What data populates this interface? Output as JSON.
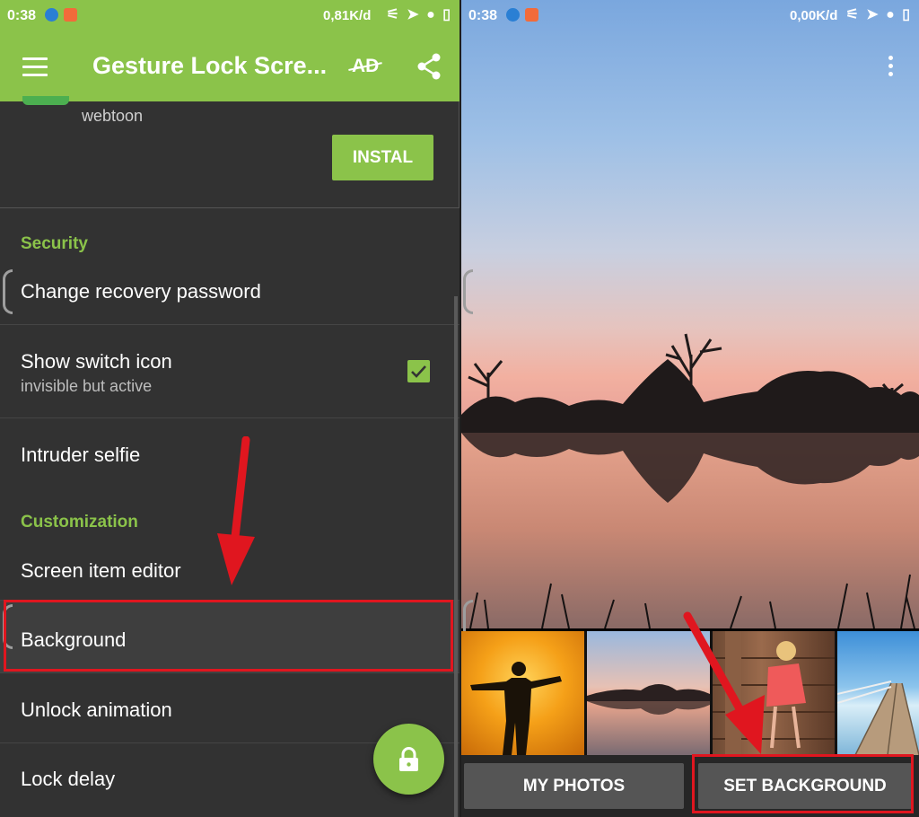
{
  "left": {
    "status": {
      "time": "0:38",
      "speed": "0,81K/d"
    },
    "app_title": "Gesture Lock Scre...",
    "ad_label": "AD",
    "ad": {
      "description": "webtoon",
      "install_label": "INSTAL"
    },
    "sections": {
      "security": "Security",
      "customization": "Customization"
    },
    "settings": {
      "change_recovery": "Change recovery password",
      "show_switch_icon": "Show switch icon",
      "show_switch_sub": "invisible but active",
      "show_switch_checked": true,
      "intruder_selfie": "Intruder selfie",
      "screen_item_editor": "Screen item editor",
      "background": "Background",
      "unlock_animation": "Unlock animation",
      "lock_delay": "Lock delay"
    }
  },
  "right": {
    "status": {
      "time": "0:38",
      "speed": "0,00K/d"
    },
    "thumbnails": [
      "silhouette-sunset",
      "lake-sunset",
      "girl-at-fence",
      "wooden-pier"
    ],
    "buttons": {
      "my_photos": "MY PHOTOS",
      "set_background": "SET BACKGROUND"
    }
  },
  "colors": {
    "accent": "#8bc34a",
    "highlight": "#e0161f",
    "background": "#323232"
  },
  "icons": [
    "menu-icon",
    "ad-off-icon",
    "share-icon",
    "check-icon",
    "lock-icon",
    "overflow-menu-icon"
  ]
}
